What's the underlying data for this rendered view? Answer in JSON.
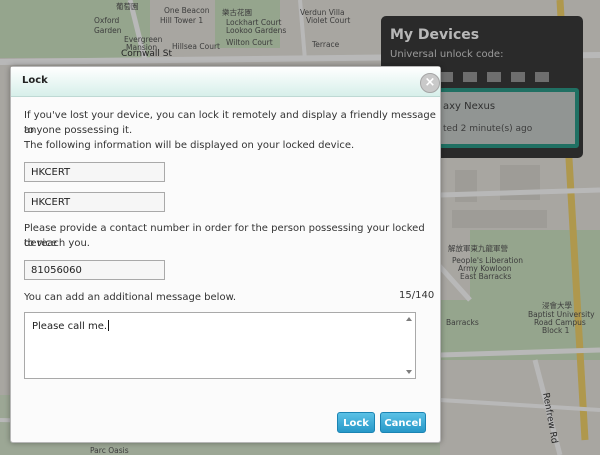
{
  "map": {
    "labels": [
      "葡萄園",
      "One Beacon",
      "樂古花園",
      "Verdun Villa",
      "Oxford",
      "Hill Tower 1",
      "Violet Court",
      "Garden",
      "Evergreen",
      "Mansion",
      "Hillsea Court",
      "Terrace",
      "Cornwall St",
      "解放軍東九龍軍營",
      "People's Liberation",
      "Army Kowloon",
      "East Barracks",
      "浸會大學",
      "Baptist University",
      "Road Campus",
      "Block 1",
      "Barracks",
      "Parc Oasis",
      "Renfrew Rd",
      "Lockhart Court",
      "Lookoo Gardens",
      "Wilton Court"
    ],
    "colors": {
      "ground": "#e9e6df",
      "park": "#cfe5c4",
      "road": "#ffffff",
      "highway": "#f3d36b"
    }
  },
  "devices": {
    "title": "My Devices",
    "unlock_label": "Universal unlock code:",
    "device_name": "axy Nexus",
    "device_updated": "ted 2 minute(s) ago",
    "accent_color": "#2d9c8a"
  },
  "dialog": {
    "title": "Lock",
    "close_icon": "close-icon",
    "intro_line1": "If you've lost your device, you can lock it remotely and display a friendly message to",
    "intro_line2": "anyone possessing it.",
    "intro_line3": "The following information will be displayed on your locked device.",
    "field1_value": "HKCERT",
    "field2_value": "HKCERT",
    "contact_line1": "Please provide a contact number in order for the person possessing your locked device",
    "contact_line2": "to reach you.",
    "phone_value": "81056060",
    "message_prompt": "You can add an additional message below.",
    "char_counter": "15/140",
    "message_value": "Please call me.",
    "lock_button": "Lock",
    "cancel_button": "Cancel",
    "button_color": "#2798c8"
  }
}
